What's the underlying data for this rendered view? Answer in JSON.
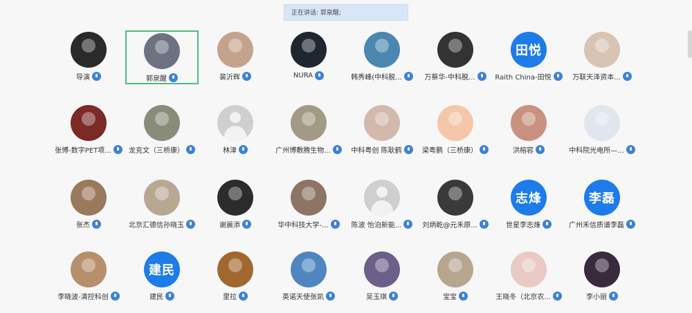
{
  "banner": {
    "text": "正在讲话: 郭泉醒;"
  },
  "participants": [
    {
      "name": "导演",
      "type": "photo",
      "color": "#2a2a2a"
    },
    {
      "name": "郭泉醒",
      "type": "photo",
      "color": "#6d7283",
      "active": true
    },
    {
      "name": "裴沂辉",
      "type": "photo",
      "color": "#c4a38c"
    },
    {
      "name": "NURA",
      "type": "photo",
      "color": "#1f2630"
    },
    {
      "name": "韩秀峰(中科脱...",
      "type": "photo",
      "color": "#4b87b0"
    },
    {
      "name": "万蔡华-中科脱...",
      "type": "photo",
      "color": "#333333"
    },
    {
      "name": "Raith China-田悦",
      "type": "initials",
      "initials": "田悦"
    },
    {
      "name": "万联天泽资本...",
      "type": "photo",
      "color": "#d8c4b4"
    },
    {
      "name": "张博-数字PET项...",
      "type": "photo",
      "color": "#7b2a25"
    },
    {
      "name": "龙克文（三桥康）",
      "type": "photo",
      "color": "#8a8c7a"
    },
    {
      "name": "林津",
      "type": "placeholder"
    },
    {
      "name": "广州博敷腾生物...",
      "type": "photo",
      "color": "#a39a86"
    },
    {
      "name": "中科粤创 陈耿鹤",
      "type": "photo",
      "color": "#d3b9ad"
    },
    {
      "name": "梁粤鹏（三桥康）",
      "type": "photo",
      "color": "#f4c7a8"
    },
    {
      "name": "洪榕容",
      "type": "photo",
      "color": "#c89180"
    },
    {
      "name": "中科院光电所—...",
      "type": "photo",
      "color": "#dfe6ee"
    },
    {
      "name": "张杰",
      "type": "photo",
      "color": "#9a7a5c"
    },
    {
      "name": "北京汇德信孙晓玉",
      "type": "photo",
      "color": "#b8a893"
    },
    {
      "name": "谢晨添",
      "type": "photo",
      "color": "#2c2c2c"
    },
    {
      "name": "华中科技大学-...",
      "type": "photo",
      "color": "#8e7464"
    },
    {
      "name": "陈波 怡泊新能...",
      "type": "placeholder"
    },
    {
      "name": "刘炳乾@元禾原...",
      "type": "photo",
      "color": "#3a3a3a"
    },
    {
      "name": "世星李志烽",
      "type": "initials",
      "initials": "志烽"
    },
    {
      "name": "广州禾信质谱李磊",
      "type": "initials",
      "initials": "李磊"
    },
    {
      "name": "李晓波-清控科创",
      "type": "photo",
      "color": "#b78f6b"
    },
    {
      "name": "建民",
      "type": "initials",
      "initials": "建民"
    },
    {
      "name": "里拉",
      "type": "photo",
      "color": "#a0682f"
    },
    {
      "name": "英诺天使张凯",
      "type": "photo",
      "color": "#4f86c0"
    },
    {
      "name": "吴玉琪",
      "type": "photo",
      "color": "#6c5f8a"
    },
    {
      "name": "宝宝",
      "type": "photo",
      "color": "#b6a690"
    },
    {
      "name": "王晓冬（北京农...",
      "type": "photo",
      "color": "#e8c9c4"
    },
    {
      "name": "李小丽",
      "type": "photo",
      "color": "#3a2a3e"
    }
  ]
}
